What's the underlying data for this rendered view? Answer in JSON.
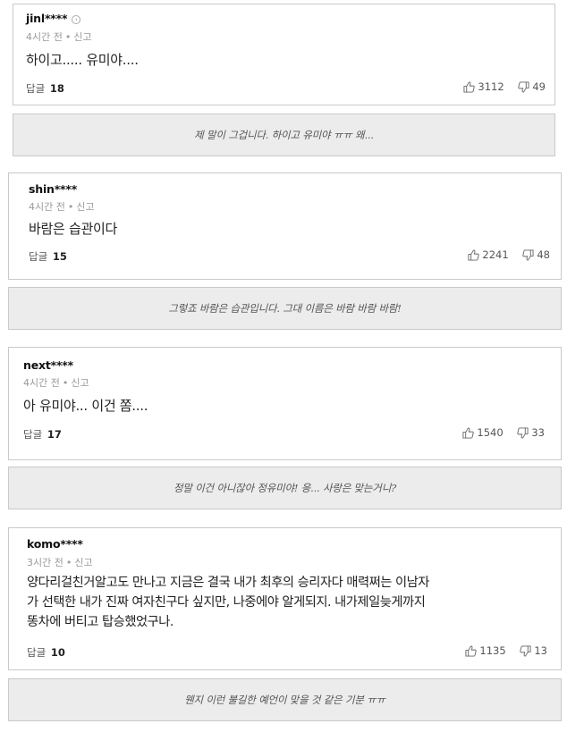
{
  "comments": [
    {
      "user": "jinl****",
      "time": "4시간 전",
      "report": "신고",
      "text": "하이고..... 유미야....",
      "reply_label": "답글",
      "reply_count": "18",
      "likes": "3112",
      "dislikes": "49",
      "caption": "제 말이 그겁니다. 하이고 유미야 ㅠㅠ 왜..."
    },
    {
      "user": "shin****",
      "time": "4시간 전",
      "report": "신고",
      "text": "바람은 습관이다",
      "reply_label": "답글",
      "reply_count": "15",
      "likes": "2241",
      "dislikes": "48",
      "caption": "그렇죠 바람은 습관입니다. 그대 이름은 바람 바람 바람!"
    },
    {
      "user": "next****",
      "time": "4시간 전",
      "report": "신고",
      "text": "아 유미야... 이건 쫌....",
      "reply_label": "답글",
      "reply_count": "17",
      "likes": "1540",
      "dislikes": "33",
      "caption": "정말 이건 아니잖아 정유미야! 응... 사랑은 맞는거니?"
    },
    {
      "user": "komo****",
      "time": "3시간 전",
      "report": "신고",
      "text_lines": [
        "양다리걸친거알고도 만나고 지금은 결국 내가 최후의 승리자다 매력쩌는 이남자",
        "가 선택한 내가 진짜 여자친구다 싶지만, 나중에야 알게되지. 내가제일늦게까지",
        "똥차에 버티고 탑승했었구나."
      ],
      "reply_label": "답글",
      "reply_count": "10",
      "likes": "1135",
      "dislikes": "13",
      "caption": "웬지 이런 불길한 예언이 맞을 것 같은 기분 ㅠㅠ"
    }
  ],
  "icons": {
    "thumbs_up": "thumbs-up-icon",
    "thumbs_down": "thumbs-down-icon",
    "profile": "chevron-right-circle-icon"
  }
}
